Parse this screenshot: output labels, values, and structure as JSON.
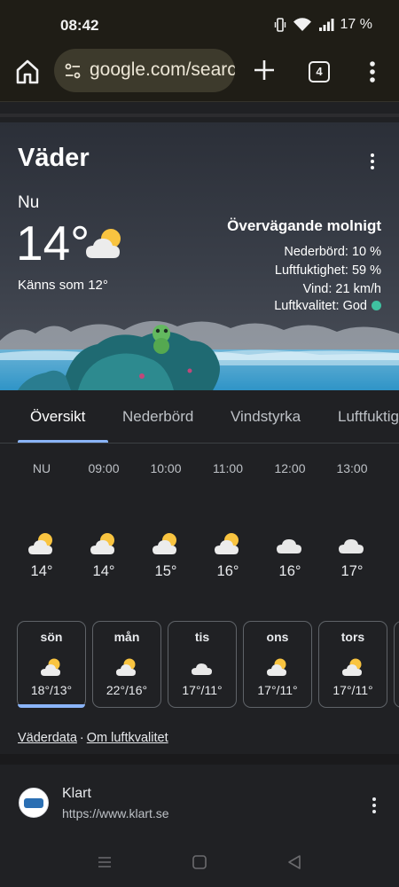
{
  "status_bar": {
    "time": "08:42",
    "battery": "17 %"
  },
  "browser": {
    "url": "google.com/search",
    "tab_count": "4",
    "icons": [
      "home-icon",
      "site-settings-icon",
      "new-tab-icon",
      "tab-switcher-icon",
      "more-vert-icon"
    ]
  },
  "weather": {
    "title": "Väder",
    "now_label": "Nu",
    "current_temp": "14°",
    "feels_like": "Känns som 12°",
    "condition": "Övervägande molnigt",
    "precipitation": "Nederbörd: 10 %",
    "humidity": "Luftfuktighet: 59 %",
    "wind": "Vind: 21 km/h",
    "air_quality": "Luftkvalitet: God",
    "air_quality_color": "#3fc1a0",
    "tabs": [
      {
        "label": "Översikt",
        "active": true
      },
      {
        "label": "Nederbörd",
        "active": false
      },
      {
        "label": "Vindstyrka",
        "active": false
      },
      {
        "label": "Luftfuktighet",
        "active": false
      }
    ],
    "hourly": [
      {
        "time": "NU",
        "temp": "14°",
        "icon": "partly-cloudy-icon"
      },
      {
        "time": "09:00",
        "temp": "14°",
        "icon": "partly-cloudy-icon"
      },
      {
        "time": "10:00",
        "temp": "15°",
        "icon": "partly-cloudy-icon"
      },
      {
        "time": "11:00",
        "temp": "16°",
        "icon": "partly-cloudy-icon"
      },
      {
        "time": "12:00",
        "temp": "16°",
        "icon": "cloudy-icon"
      },
      {
        "time": "13:00",
        "temp": "17°",
        "icon": "cloudy-icon"
      }
    ],
    "daily": [
      {
        "day": "sön",
        "temps": "18°/13°",
        "icon": "partly-cloudy-icon",
        "selected": true
      },
      {
        "day": "mån",
        "temps": "22°/16°",
        "icon": "partly-cloudy-icon",
        "selected": false
      },
      {
        "day": "tis",
        "temps": "17°/11°",
        "icon": "cloudy-icon",
        "selected": false
      },
      {
        "day": "ons",
        "temps": "17°/11°",
        "icon": "partly-cloudy-icon",
        "selected": false
      },
      {
        "day": "tors",
        "temps": "17°/11°",
        "icon": "partly-cloudy-icon",
        "selected": false
      }
    ],
    "links": {
      "weather_data": "Väderdata",
      "separator": "·",
      "air_quality_info": "Om luftkvalitet"
    }
  },
  "result": {
    "site_name": "Klart",
    "site_url": "https://www.klart.se",
    "logo_text": "klart"
  },
  "colors": {
    "accent": "#8ab4f8",
    "sun": "#f9c440",
    "cloud": "#e8e8e8"
  }
}
